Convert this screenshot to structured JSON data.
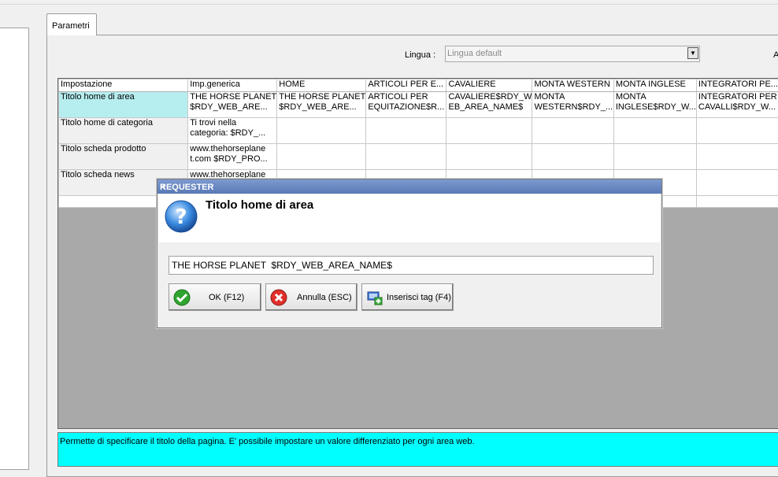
{
  "tab": {
    "label": "Parametri"
  },
  "lingua": {
    "label": "Lingua :",
    "value": "Lingua default",
    "right_cut": "A"
  },
  "grid": {
    "columns": [
      "Impostazione",
      "Imp.generica",
      "HOME",
      "ARTICOLI PER E...",
      "CAVALIERE",
      "MONTA WESTERN",
      "MONTA INGLESE",
      "INTEGRATORI PE..."
    ],
    "rows": [
      {
        "label": "Titolo home di area",
        "cells": [
          [
            "THE HORSE PLANET",
            " $RDY_WEB_ARE..."
          ],
          [
            "THE HORSE PLANET",
            " $RDY_WEB_ARE..."
          ],
          [
            "ARTICOLI PER",
            "EQUITAZIONE$R..."
          ],
          [
            "CAVALIERE$RDY_W",
            "EB_AREA_NAME$"
          ],
          [
            "MONTA",
            "WESTERN$RDY_..."
          ],
          [
            "MONTA",
            "INGLESE$RDY_W..."
          ],
          [
            "INTEGRATORI PER",
            "CAVALLI$RDY_W..."
          ]
        ]
      },
      {
        "label": "Titolo home di categoria",
        "cells": [
          [
            "Ti trovi nella",
            "categoria: $RDY_..."
          ],
          [],
          [],
          [],
          [],
          [],
          []
        ]
      },
      {
        "label": "Titolo scheda prodotto",
        "cells": [
          [
            "www.thehorseplane",
            "t.com $RDY_PRO..."
          ],
          [],
          [],
          [],
          [],
          [],
          []
        ]
      },
      {
        "label": "Titolo scheda news",
        "cells": [
          [
            "www.thehorseplane",
            ""
          ],
          [],
          [],
          [],
          [],
          [],
          []
        ]
      }
    ]
  },
  "info": {
    "text": "Permette di specificare il titolo della pagina. E' possibile impostare un valore differenziato per ogni area web."
  },
  "dialog": {
    "title": "REQUESTER",
    "close": "×",
    "heading": "Titolo home di area",
    "input_value": "THE HORSE PLANET  $RDY_WEB_AREA_NAME$",
    "buttons": {
      "ok": "OK (F12)",
      "cancel": "Annulla (ESC)",
      "tag": "Inserisci tag (F4)"
    },
    "icons": {
      "question": "question-icon",
      "ok": "check-icon",
      "cancel": "cancel-icon",
      "tag": "insert-tag-icon"
    }
  },
  "colors": {
    "selected_row": "#b6eef0",
    "info_bar": "#00ffff",
    "dialog_title": "#6a88c4"
  }
}
